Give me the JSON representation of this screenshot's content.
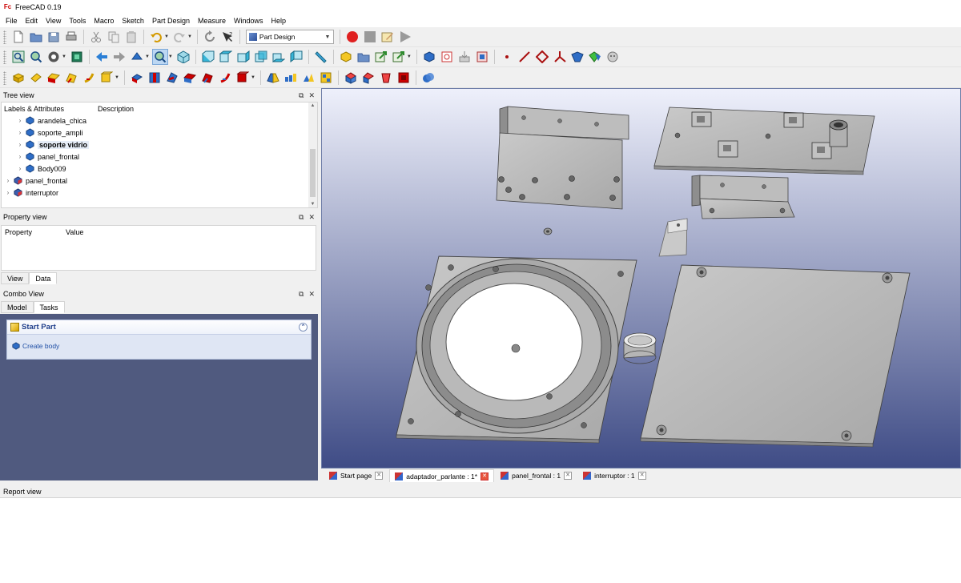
{
  "window": {
    "title": "FreeCAD 0.19"
  },
  "menu": [
    "File",
    "Edit",
    "View",
    "Tools",
    "Macro",
    "Sketch",
    "Part Design",
    "Measure",
    "Windows",
    "Help"
  ],
  "workbench": {
    "selected": "Part Design"
  },
  "tree_view": {
    "title": "Tree view",
    "columns": [
      "Labels & Attributes",
      "Description"
    ],
    "items": [
      {
        "label": "arandela_chica"
      },
      {
        "label": "soporte_ampli"
      },
      {
        "label": "soporte vidrio"
      },
      {
        "label": "panel_frontal"
      },
      {
        "label": "Body009"
      },
      {
        "label": "panel_frontal"
      },
      {
        "label": "interruptor"
      }
    ]
  },
  "property_view": {
    "title": "Property view",
    "columns": [
      "Property",
      "Value"
    ],
    "tabs": [
      "View",
      "Data"
    ]
  },
  "combo_view": {
    "title": "Combo View",
    "tabs": [
      "Model",
      "Tasks"
    ],
    "task_panel": {
      "title": "Start Part",
      "action": "Create body"
    }
  },
  "document_tabs": [
    {
      "label": "Start page"
    },
    {
      "label": "adaptador_parlante : 1*"
    },
    {
      "label": "panel_frontal : 1"
    },
    {
      "label": "interruptor : 1"
    }
  ],
  "report_view": {
    "title": "Report view"
  },
  "icons": {
    "header_float": "float-icon",
    "header_close": "close-icon"
  },
  "colors": {
    "viewport_top": "#eef0fb",
    "viewport_bottom": "#3f4c86",
    "record": "#e02020",
    "accent": "#1f4fa5"
  }
}
